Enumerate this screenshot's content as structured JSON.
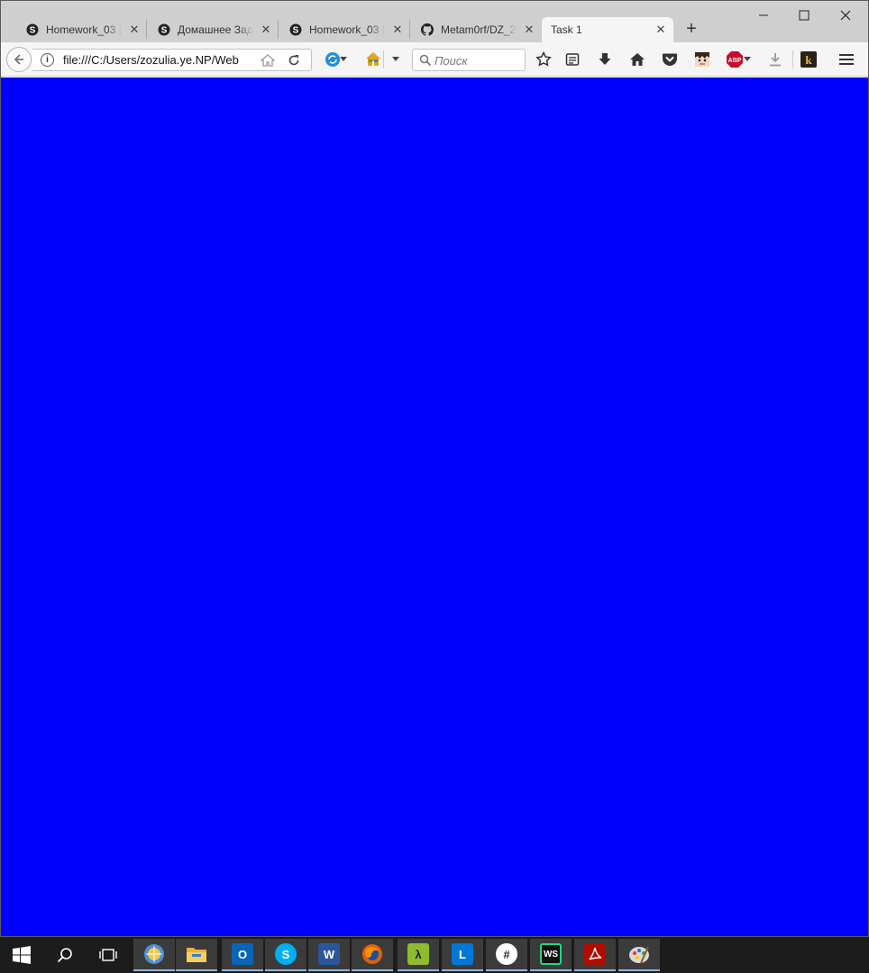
{
  "browser": {
    "tabs": [
      {
        "title": "Homework_03 |",
        "icon": "skype-icon",
        "active": false
      },
      {
        "title": "Домашнее Зад",
        "icon": "skype-icon",
        "active": false
      },
      {
        "title": "Homework_03 |",
        "icon": "skype-icon",
        "active": false
      },
      {
        "title": "Metam0rf/DZ_2",
        "icon": "github-icon",
        "active": false
      },
      {
        "title": "Task 1",
        "icon": "none",
        "active": true
      }
    ],
    "url": "file:///C:/Users/zozulia.ye.NP/Web",
    "search_placeholder": "Поиск",
    "abp_label": "ABP",
    "page_background": "#0000ff"
  },
  "taskbar": {
    "apps": [
      {
        "name": "outlook",
        "label": "O"
      },
      {
        "name": "skype",
        "label": "S"
      },
      {
        "name": "word",
        "label": "W"
      },
      {
        "name": "firefox",
        "label": ""
      },
      {
        "name": "lambda",
        "label": "λ"
      },
      {
        "name": "lync",
        "label": "L"
      },
      {
        "name": "slack",
        "label": "#"
      },
      {
        "name": "webstorm",
        "label": "WS"
      },
      {
        "name": "acrobat",
        "label": ""
      },
      {
        "name": "paint",
        "label": ""
      }
    ]
  }
}
